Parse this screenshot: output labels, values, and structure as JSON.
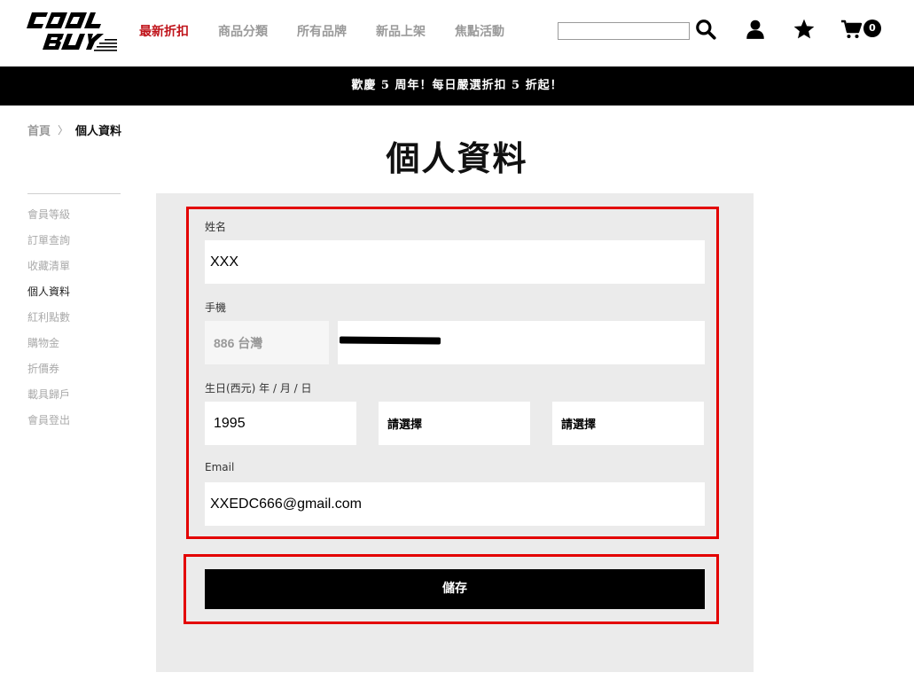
{
  "header": {
    "nav": [
      {
        "label": "最新折扣",
        "active": true
      },
      {
        "label": "商品分類",
        "active": false
      },
      {
        "label": "所有品牌",
        "active": false
      },
      {
        "label": "新品上架",
        "active": false
      },
      {
        "label": "焦點活動",
        "active": false
      }
    ],
    "search_value": "",
    "cart_count": "0",
    "icons": [
      "search-icon",
      "user-icon",
      "star-icon",
      "cart-icon"
    ]
  },
  "banner": {
    "text": "歡慶 5 周年！每日嚴選折扣 5 折起！"
  },
  "breadcrumb": {
    "home": "首頁",
    "separator": "〉",
    "current": "個人資料"
  },
  "page_title": "個人資料",
  "sidebar": {
    "items": [
      {
        "label": "會員等級",
        "active": false
      },
      {
        "label": "訂單查詢",
        "active": false
      },
      {
        "label": "收藏清單",
        "active": false
      },
      {
        "label": "個人資料",
        "active": true
      },
      {
        "label": "紅利點數",
        "active": false
      },
      {
        "label": "購物金",
        "active": false
      },
      {
        "label": "折價券",
        "active": false
      },
      {
        "label": "載具歸戶",
        "active": false
      },
      {
        "label": "會員登出",
        "active": false
      }
    ]
  },
  "form": {
    "name_label": "姓名",
    "name_value": "XXX",
    "phone_label": "手機",
    "phone_country": "886 台灣",
    "phone_value": "",
    "birthday_label": "生日(西元) 年 / 月 / 日",
    "birth_year": "1995",
    "birth_month": "請選擇",
    "birth_day": "請選擇",
    "email_label": "Email",
    "email_value": "XXEDC666@gmail.com",
    "save_label": "儲存"
  },
  "colors": {
    "accent": "#c0141b",
    "highlight": "#e30000",
    "banner_bg": "#000000",
    "panel_bg": "#ebebeb"
  }
}
